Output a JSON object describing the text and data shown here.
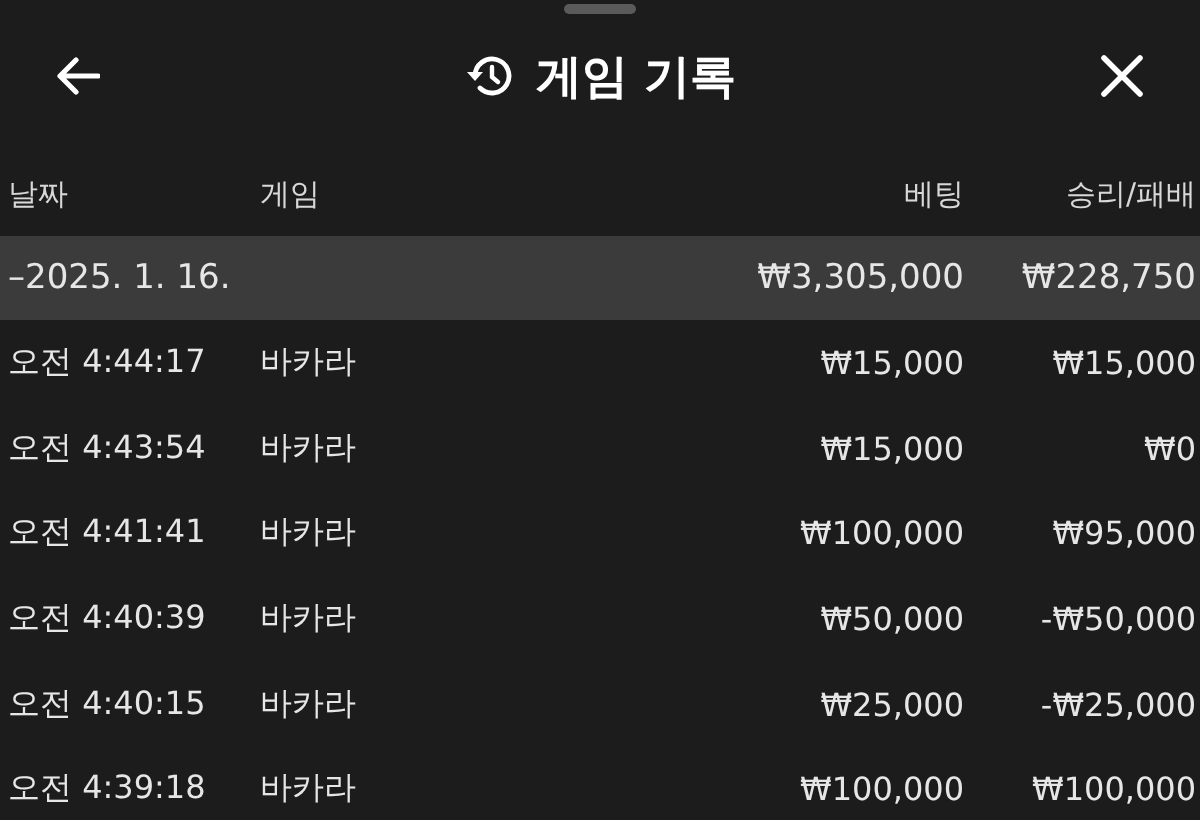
{
  "header": {
    "title": "게임 기록"
  },
  "table": {
    "columns": [
      "날짜",
      "게임",
      "베팅",
      "승리/패배"
    ],
    "group": {
      "date": "–2025. 1. 16.",
      "bet": "₩3,305,000",
      "result": "₩228,750"
    },
    "rows": [
      {
        "time": "오전 4:44:17",
        "game": "바카라",
        "bet": "₩15,000",
        "result": "₩15,000"
      },
      {
        "time": "오전 4:43:54",
        "game": "바카라",
        "bet": "₩15,000",
        "result": "₩0"
      },
      {
        "time": "오전 4:41:41",
        "game": "바카라",
        "bet": "₩100,000",
        "result": "₩95,000"
      },
      {
        "time": "오전 4:40:39",
        "game": "바카라",
        "bet": "₩50,000",
        "result": "-₩50,000"
      },
      {
        "time": "오전 4:40:15",
        "game": "바카라",
        "bet": "₩25,000",
        "result": "-₩25,000"
      },
      {
        "time": "오전 4:39:18",
        "game": "바카라",
        "bet": "₩100,000",
        "result": "₩100,000"
      }
    ]
  }
}
